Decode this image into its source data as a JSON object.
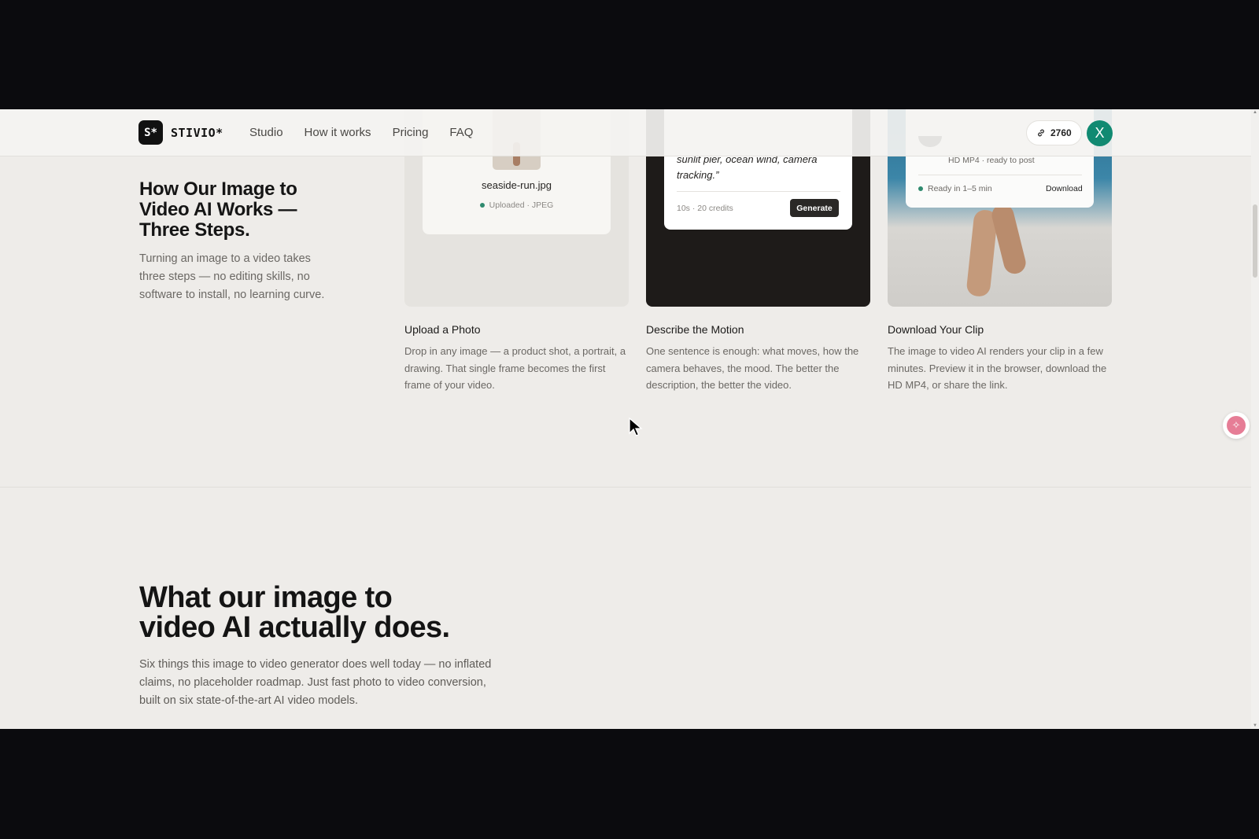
{
  "brand": {
    "mark": "S*",
    "name": "STIVIO*"
  },
  "nav": [
    "Studio",
    "How it works",
    "Pricing",
    "FAQ"
  ],
  "credits": "2760",
  "user_initial": "X",
  "intro": {
    "title": "How Our Image to Video AI Works — Three Steps.",
    "description": "Turning an image to a video takes three steps — no editing skills, no software to install, no learning curve."
  },
  "steps": [
    {
      "card": {
        "file_name": "seaside-run.jpg",
        "status": "Uploaded · JPEG"
      },
      "title": "Upload a Photo",
      "description": "Drop in any image — a product shot, a portrait, a drawing. That single frame becomes the first frame of your video."
    },
    {
      "card": {
        "prompt": "sunlit pier, ocean wind, camera tracking.”",
        "meta": "10s · 20 credits",
        "button": "Generate"
      },
      "title": "Describe the Motion",
      "description": "One sentence is enough: what moves, how the camera behaves, the mood. The better the description, the better the video."
    },
    {
      "card": {
        "subtitle": "HD MP4 · ready to post",
        "ready": "Ready in 1–5 min",
        "link": "Download"
      },
      "title": "Download Your Clip",
      "description": "The image to video AI renders your clip in a few minutes. Preview it in the browser, download the HD MP4, or share the link."
    }
  ],
  "features": {
    "title": "What our image to video AI actually does.",
    "description": "Six things this image to video generator does well today — no inflated claims, no placeholder roadmap. Just fast photo to video conversion, built on six state-of-the-art AI video models."
  },
  "colors": {
    "accent": "#118a72",
    "dark": "#111111",
    "background": "#eeece9"
  }
}
